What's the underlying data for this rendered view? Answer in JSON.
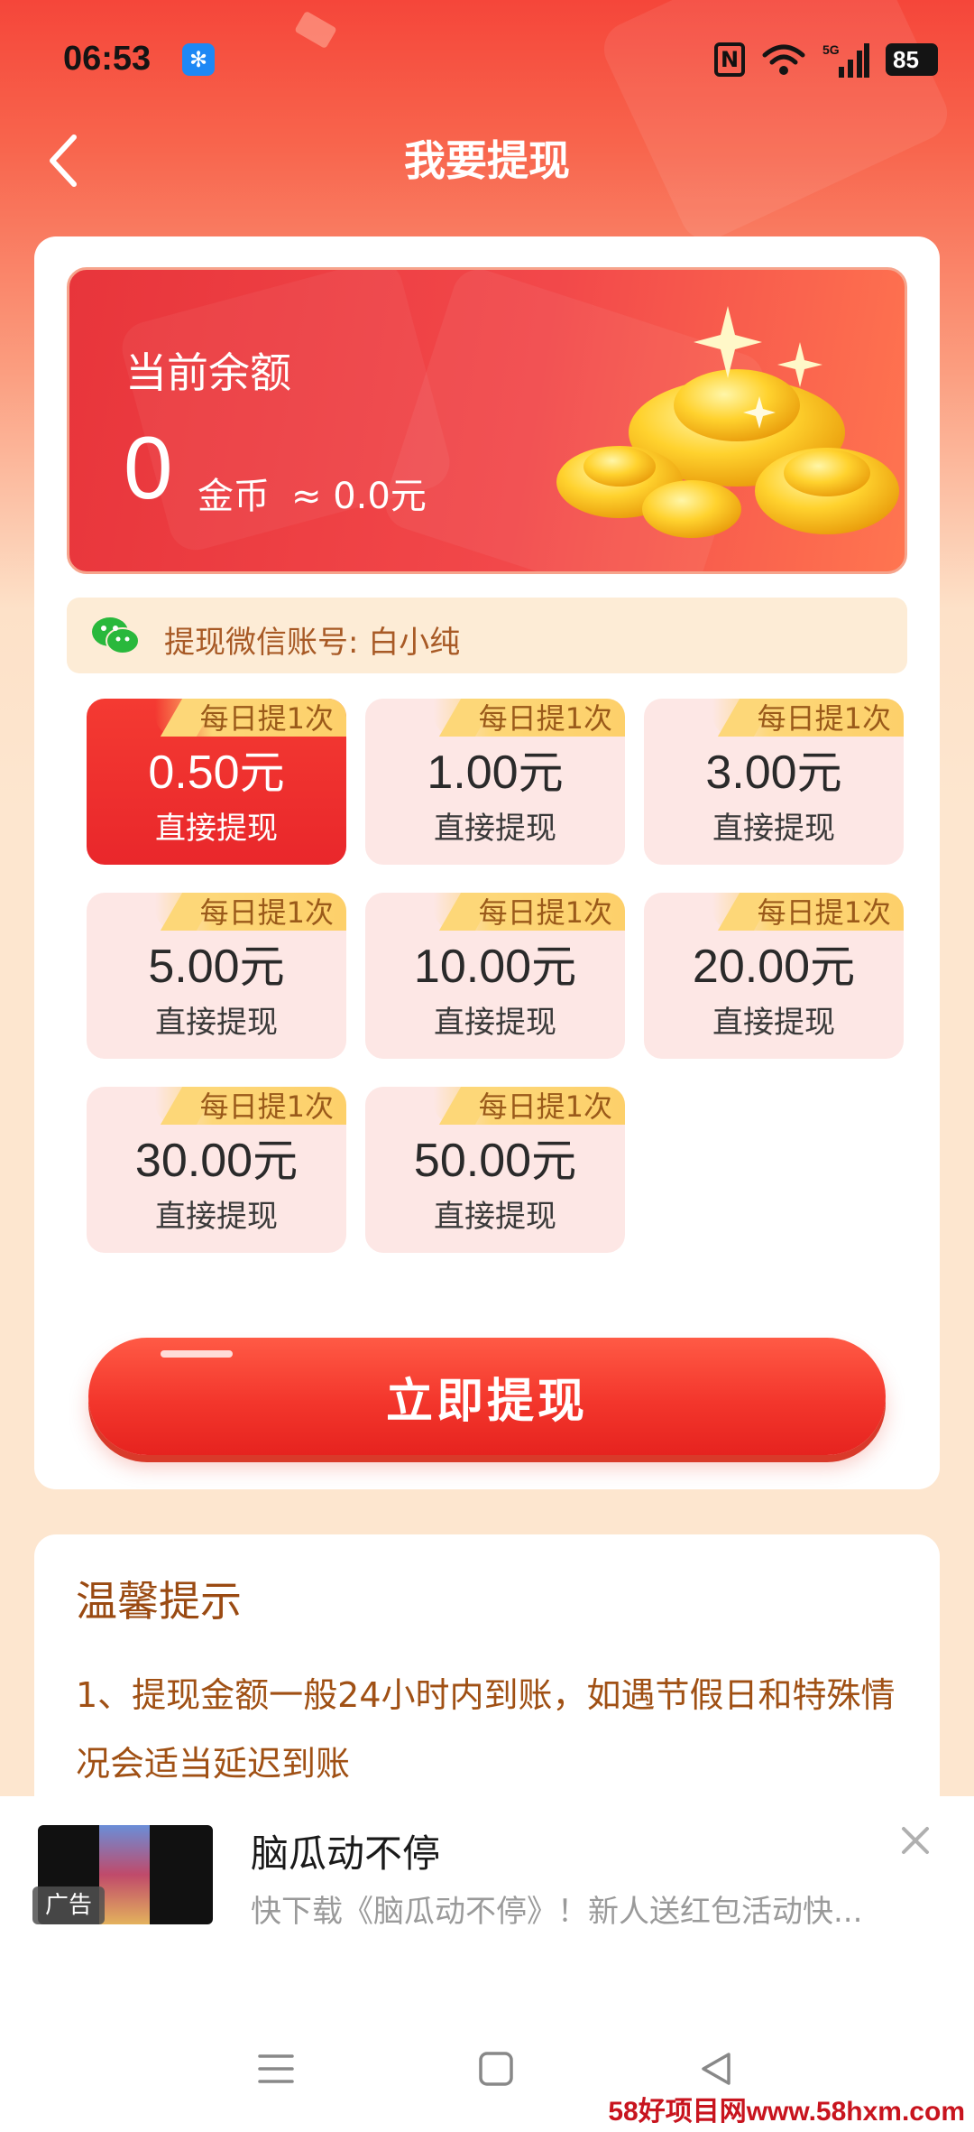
{
  "status_bar": {
    "time": "06:53",
    "network": "5G",
    "battery": "85"
  },
  "header": {
    "title": "我要提现"
  },
  "balance": {
    "label": "当前余额",
    "amount": "0",
    "unit": "金币",
    "approx": "≈ 0.0元"
  },
  "account": {
    "text": "提现微信账号: 白小纯"
  },
  "options": [
    {
      "badge": "每日提1次",
      "amount": "0.50",
      "unit": "元",
      "sub": "直接提现",
      "selected": true
    },
    {
      "badge": "每日提1次",
      "amount": "1.00",
      "unit": "元",
      "sub": "直接提现",
      "selected": false
    },
    {
      "badge": "每日提1次",
      "amount": "3.00",
      "unit": "元",
      "sub": "直接提现",
      "selected": false
    },
    {
      "badge": "每日提1次",
      "amount": "5.00",
      "unit": "元",
      "sub": "直接提现",
      "selected": false
    },
    {
      "badge": "每日提1次",
      "amount": "10.00",
      "unit": "元",
      "sub": "直接提现",
      "selected": false
    },
    {
      "badge": "每日提1次",
      "amount": "20.00",
      "unit": "元",
      "sub": "直接提现",
      "selected": false
    },
    {
      "badge": "每日提1次",
      "amount": "30.00",
      "unit": "元",
      "sub": "直接提现",
      "selected": false
    },
    {
      "badge": "每日提1次",
      "amount": "50.00",
      "unit": "元",
      "sub": "直接提现",
      "selected": false
    }
  ],
  "withdraw_button": "立即提现",
  "tips": {
    "title": "温馨提示",
    "line1": "1、提现金额一般24小时内到账，如遇节假日和特殊情况会适当延迟到账"
  },
  "ad": {
    "tag": "广告",
    "title": "脑瓜动不停",
    "desc": "快下载《脑瓜动不停》！新人送红包活动快..."
  },
  "watermark": "58好项目网www.58hxm.com",
  "colors": {
    "primary_red": "#f3362c",
    "tip_brown": "#9a4a12",
    "badge_gold": "#fdd778"
  }
}
